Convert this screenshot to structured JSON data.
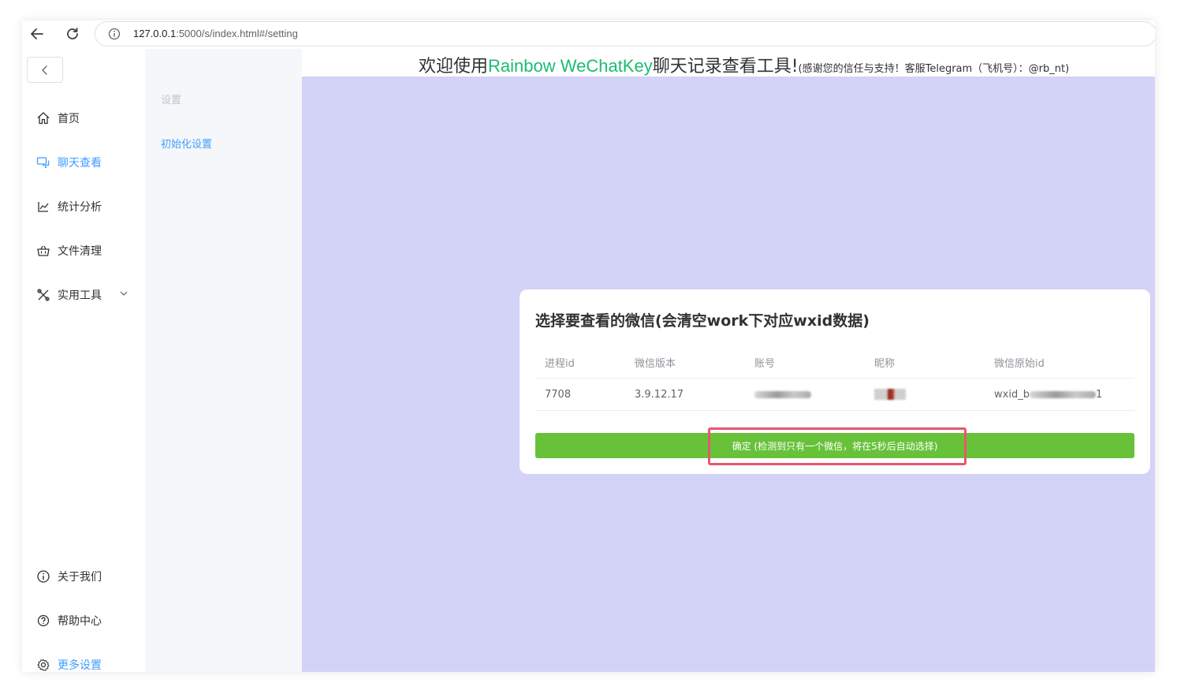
{
  "browser": {
    "url_host": "127.0.0.1",
    "url_rest": ":5000/s/index.html#/setting"
  },
  "sidebar": {
    "items": [
      {
        "label": "首页",
        "icon": "home-icon"
      },
      {
        "label": "聊天查看",
        "icon": "chat-icon",
        "active": true
      },
      {
        "label": "统计分析",
        "icon": "chart-icon"
      },
      {
        "label": "文件清理",
        "icon": "basket-icon"
      },
      {
        "label": "实用工具",
        "icon": "tools-icon"
      }
    ],
    "bottom_items": [
      {
        "label": "关于我们",
        "icon": "info-icon"
      },
      {
        "label": "帮助中心",
        "icon": "help-icon"
      },
      {
        "label": "更多设置",
        "icon": "gear-icon"
      }
    ]
  },
  "submenu": {
    "title": "设置",
    "item": "初始化设置"
  },
  "header": {
    "prefix": "欢迎使用",
    "brand": "Rainbow WeChatKey",
    "suffix": "聊天记录查看工具!",
    "note": "(感谢您的信任与支持！客服Telegram（飞机号）：@rb_nt)"
  },
  "dialog": {
    "title": "选择要查看的微信(会清空work下对应wxid数据)",
    "columns": [
      "进程id",
      "微信版本",
      "账号",
      "昵称",
      "微信原始id"
    ],
    "rows": [
      {
        "pid": "7708",
        "version": "3.9.12.17",
        "wxid_prefix": "wxid_b",
        "wxid_suffix": "1"
      }
    ],
    "confirm_label": "确定 (检测到只有一个微信，将在5秒后自动选择)"
  },
  "colors": {
    "accent": "#409eff",
    "brand": "#1bbc72",
    "content_bg": "#d3d3f7",
    "confirm_bg": "#67c23a",
    "highlight": "#e8576d"
  }
}
